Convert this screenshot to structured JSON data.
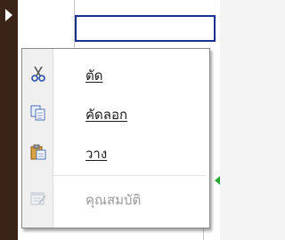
{
  "context_menu": {
    "items": [
      {
        "label": "ตัด",
        "icon": "scissors-icon",
        "enabled": true
      },
      {
        "label": "คัดลอก",
        "icon": "copy-icon",
        "enabled": true
      },
      {
        "label": "วาง",
        "icon": "paste-icon",
        "enabled": true
      },
      {
        "label": "คุณสมบัติ",
        "icon": "properties-icon",
        "enabled": false
      }
    ]
  },
  "colors": {
    "strip": "#3a2418",
    "input_border": "#1a2f8c",
    "disabled_text": "#9a9a9a"
  }
}
